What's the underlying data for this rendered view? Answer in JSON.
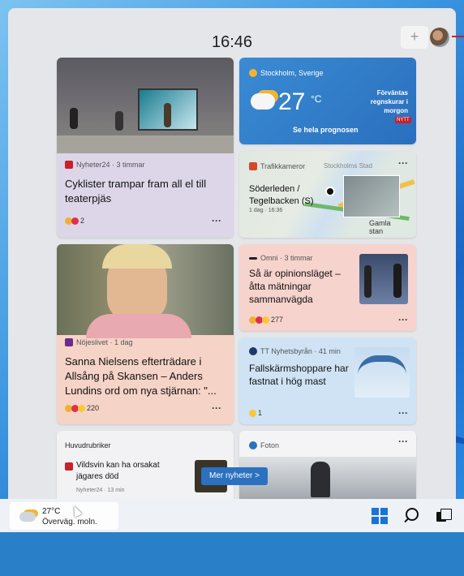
{
  "panel": {
    "clock": "16:46",
    "add_label": "+"
  },
  "cards": {
    "c1": {
      "source": "Nyheter24 · 3 timmar",
      "title": "Cyklister trampar fram all el till teaterpjäs",
      "reactions": "2",
      "more": "···"
    },
    "weather": {
      "location": "Stockholm, Sverige",
      "temp": "27",
      "unit": "°C",
      "forecast": "Förväntas regnskurar i morgon",
      "link": "Se hela prognosen",
      "badge": "NYTT"
    },
    "traffic": {
      "source": "Trafikkameror",
      "place": "Söderleden / Tegelbacken (S)",
      "time": "1 dag · 16:36",
      "map_label_1": "Stockholms Stad",
      "map_label_2": "Gamla stan",
      "more": "···"
    },
    "c2": {
      "source": "Nöjeslivet · 1 dag",
      "title": "Sanna Nielsens efterträdare i Allsång på Skansen – Anders Lundins ord om nya stjärnan: \"...",
      "reactions": "220",
      "more": "···"
    },
    "c3": {
      "source": "Omni · 3 timmar",
      "title": "Så är opinionsläget – åtta mätningar sammanvägda",
      "reactions": "277",
      "more": "···"
    },
    "c4": {
      "source": "TT Nyhetsbyrån · 41 min",
      "title": "Fallskärmshoppare har fastnat i hög mast",
      "reactions": "1",
      "more": "···"
    },
    "c5": {
      "header": "Huvudrubriker",
      "item": "Vildsvin kan ha orsakat jägares död",
      "sub": "Nyheter24 · 13 min"
    },
    "c6": {
      "source": "Foton",
      "more": "···"
    }
  },
  "more_news": "Mer nyheter  >",
  "taskbar": {
    "temp": "27°C",
    "cond": "Överväg. moln."
  },
  "colors": {
    "accent": "#2b71c0",
    "red": "#c9202a"
  }
}
